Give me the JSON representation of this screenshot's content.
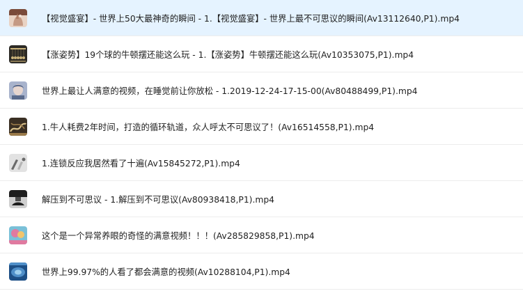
{
  "files": [
    {
      "name": "【视觉盛宴】- 世界上50大最神奇的瞬间 - 1.【视觉盛宴】- 世界上最不可思议的瞬间(Av13112640,P1).mp4",
      "thumbnail": "video-thumbnail-hand",
      "colors": [
        "#7a4b3a",
        "#c59a84",
        "#e9d3c4"
      ]
    },
    {
      "name": "【涨姿势】19个球的牛顿摆还能这么玩 - 1.【涨姿势】牛顿摆还能这么玩(Av10353075,P1).mp4",
      "thumbnail": "video-thumbnail-newtons-cradle",
      "colors": [
        "#2c2a25",
        "#8a7a55",
        "#c9b27a"
      ]
    },
    {
      "name": "世界上最让人满意的视频，在睡觉前让你放松 - 1.2019-12-24-17-15-00(Av80488499,P1).mp4",
      "thumbnail": "video-thumbnail-face",
      "colors": [
        "#5b6b8c",
        "#a8b3cc",
        "#e7d6cf"
      ]
    },
    {
      "name": "1.牛人耗费2年时间，打造的循环轨道，众人呼太不可思议了！(Av16514558,P1).mp4",
      "thumbnail": "video-thumbnail-track",
      "colors": [
        "#3a2f23",
        "#9b7b4a",
        "#d8c08a"
      ]
    },
    {
      "name": "1.连锁反应我居然看了十遍(Av15845272,P1).mp4",
      "thumbnail": "video-thumbnail-domino",
      "colors": [
        "#6a6a6a",
        "#b5b5b5",
        "#e2e2e2"
      ]
    },
    {
      "name": "解压到不可思议 - 1.解压到不可思议(Av80938418,P1).mp4",
      "thumbnail": "video-thumbnail-press",
      "colors": [
        "#1e1e1e",
        "#4d4d4d",
        "#cfcfcf"
      ]
    },
    {
      "name": "这个是一个异常养眼的奇怪的满意视频！！！(Av285829858,P1).mp4",
      "thumbnail": "video-thumbnail-colorful",
      "colors": [
        "#e07aa0",
        "#f2c46b",
        "#7ac0d8"
      ]
    },
    {
      "name": "世界上99.97%的人看了都会满意的视频(Av10288104,P1).mp4",
      "thumbnail": "video-thumbnail-blue",
      "colors": [
        "#1d4f86",
        "#4f8fc9",
        "#9fd0ef"
      ]
    }
  ]
}
